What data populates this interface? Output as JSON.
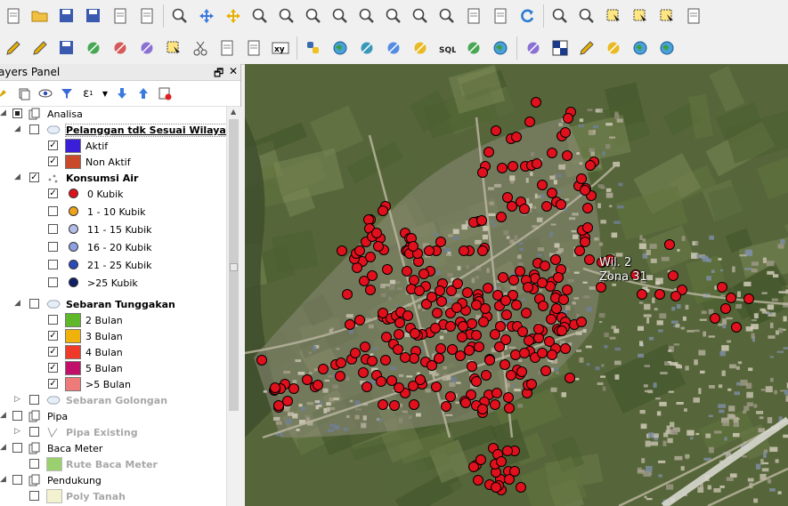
{
  "panel": {
    "title": "ayers Panel",
    "float_icon": "restore-icon",
    "close_icon": "close-icon"
  },
  "layers": [
    {
      "name": "Analisa",
      "type": "group",
      "checked": "partial",
      "expanded": true
    },
    {
      "name": "Pelanggan tdk Sesuai Wilayah",
      "type": "polygon",
      "checked": false,
      "expanded": true
    },
    {
      "name": "Aktif",
      "type": "class",
      "color": "#3a1fd8",
      "checked": true
    },
    {
      "name": "Non Aktif",
      "type": "class",
      "color": "#c94a2a",
      "checked": true
    },
    {
      "name": "Konsumsi Air",
      "type": "point",
      "checked": true,
      "expanded": true
    },
    {
      "name": "0 Kubik",
      "type": "pointclass",
      "color": "#e0101c",
      "checked": true
    },
    {
      "name": "1 - 10 Kubik",
      "type": "pointclass",
      "color": "#f0a21a",
      "checked": false
    },
    {
      "name": "11 - 15  Kubik",
      "type": "pointclass",
      "color": "#b4bde8",
      "checked": false
    },
    {
      "name": "16 - 20  Kubik",
      "type": "pointclass",
      "color": "#8fa0e0",
      "checked": false
    },
    {
      "name": "21 - 25  Kubik",
      "type": "pointclass",
      "color": "#2a4ab8",
      "checked": false
    },
    {
      "name": ">25 Kubik",
      "type": "pointclass",
      "color": "#0f1f6a",
      "checked": false
    },
    {
      "name": "Sebaran Tunggakan",
      "type": "polygon",
      "checked": false,
      "expanded": true
    },
    {
      "name": "2 Bulan",
      "type": "class",
      "color": "#5fb82a",
      "checked": false
    },
    {
      "name": "3 Bulan",
      "type": "class",
      "color": "#f0b20a",
      "checked": true
    },
    {
      "name": "4 Bulan",
      "type": "class",
      "color": "#ef3a2a",
      "checked": true
    },
    {
      "name": "5 Bulan",
      "type": "class",
      "color": "#c0106a",
      "checked": true
    },
    {
      "name": ">5 Bulan",
      "type": "class",
      "color": "#ee7a7a",
      "checked": true
    },
    {
      "name": "Sebaran Golongan",
      "type": "polygon-off",
      "checked": false,
      "expanded": false
    },
    {
      "name": "Pipa",
      "type": "group",
      "checked": false,
      "expanded": true
    },
    {
      "name": "Pipa Existing",
      "type": "line-off",
      "checked": false,
      "expanded": false
    },
    {
      "name": "Baca Meter",
      "type": "group",
      "checked": false,
      "expanded": true
    },
    {
      "name": "Rute Baca Meter",
      "type": "rute-off",
      "checked": false
    },
    {
      "name": "Pendukung",
      "type": "group",
      "checked": false,
      "expanded": true
    },
    {
      "name": "Poly Tanah",
      "type": "poly-off",
      "checked": false
    }
  ],
  "map": {
    "label_line1": "Wil. 2",
    "label_line2": "Zona 31",
    "point_color": "#e0101c"
  },
  "toolbar1_icons": [
    "new-project-icon",
    "open-project-icon",
    "save-project-icon",
    "save-as-icon",
    "new-print-layout-icon",
    "layout-manager-icon",
    "touch-zoom-icon",
    "pan-icon",
    "pan-to-selection-icon",
    "zoom-in-icon",
    "zoom-out-icon",
    "zoom-native-icon",
    "zoom-full-icon",
    "zoom-to-selection-icon",
    "zoom-to-layer-icon",
    "zoom-last-icon",
    "zoom-next-icon",
    "new-bookmark-icon",
    "show-bookmarks-icon",
    "refresh-icon",
    "identify-icon",
    "map-tips-icon",
    "select-feature-icon",
    "expression-select-icon",
    "deselect-icon",
    "attribute-table-icon"
  ],
  "toolbar2_icons": [
    "digitize-icon",
    "edit-pencil-icon",
    "save-edits-icon",
    "add-feature-icon",
    "vertex-tool-icon",
    "add-ring-icon",
    "delete-selected-icon",
    "cut-icon",
    "copy-icon",
    "paste-icon",
    "xy-label-icon",
    "python-icon",
    "globe-plugin-icon",
    "raster-plugin-icon",
    "pipe-tool-icon",
    "user-plugin-icon",
    "sql-icon",
    "postgis-icon",
    "terrain-icon",
    "node-add-icon",
    "grid-icon",
    "feather-icon",
    "elephant-db-icon",
    "globe-add-icon",
    "network-globe-icon"
  ]
}
